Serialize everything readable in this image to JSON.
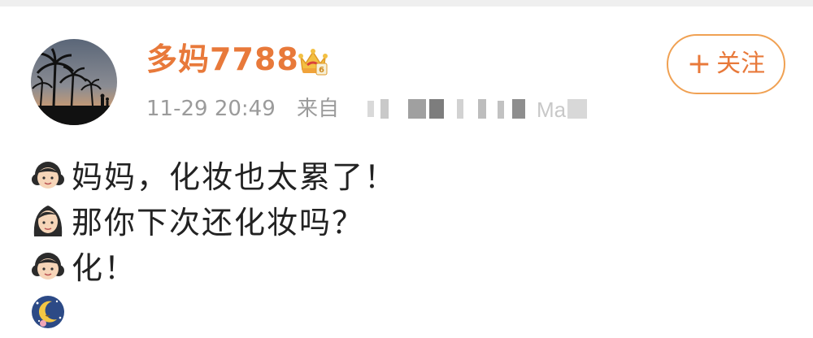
{
  "post": {
    "username": "多妈7788",
    "timestamp": "11-29 20:49",
    "source_prefix": "来自",
    "source_visible_fragment": "Ma",
    "follow_label": "关注",
    "follow_icon": "plus-icon",
    "vip_badge_icon": "crown-icon",
    "lines": [
      {
        "emoji": "girl-emoji",
        "text": "妈妈，化妆也太累了！"
      },
      {
        "emoji": "woman-emoji",
        "text": "那你下次还化妆吗？"
      },
      {
        "emoji": "girl-emoji",
        "text": "化！"
      },
      {
        "emoji": "moon-emoji",
        "text": ""
      }
    ]
  },
  "colors": {
    "accent": "#e8793a",
    "button_border": "#f0a153",
    "meta_text": "#9b9b9b",
    "body_text": "#222222"
  }
}
